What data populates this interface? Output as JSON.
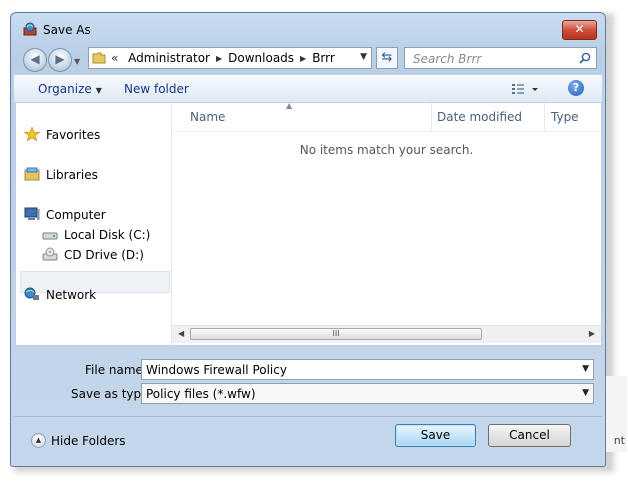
{
  "window": {
    "title": "Save As",
    "close_glyph": "✕"
  },
  "navigation": {
    "back_icon": "back-arrow-icon",
    "forward_icon": "forward-arrow-icon",
    "breadcrumb_overflow": "«",
    "breadcrumbs": [
      "Administrator",
      "Downloads",
      "Brrr"
    ],
    "search_placeholder": "Search Brrr"
  },
  "toolbar": {
    "organize_label": "Organize",
    "new_folder_label": "New folder"
  },
  "nav_pane": {
    "favorites": "Favorites",
    "libraries": "Libraries",
    "computer": "Computer",
    "local_disk": "Local Disk (C:)",
    "cd_drive": "CD Drive (D:)",
    "network": "Network"
  },
  "file_list": {
    "columns": [
      "Name",
      "Date modified",
      "Type"
    ],
    "empty_message": "No items match your search.",
    "scroll_grip": "III"
  },
  "form": {
    "file_name_label": "File name:",
    "file_name_value": "Windows Firewall Policy",
    "save_type_label": "Save as type:",
    "save_type_value": "Policy files (*.wfw)"
  },
  "footer": {
    "hide_folders_label": "Hide Folders",
    "save_label": "Save",
    "cancel_label": "Cancel"
  },
  "background": {
    "fragment_text": "nt"
  },
  "colors": {
    "window_frame": "#c9dcef",
    "close_button": "#cf4f3a",
    "link_text": "#1e3287",
    "save_button": "#c8e6fa"
  }
}
